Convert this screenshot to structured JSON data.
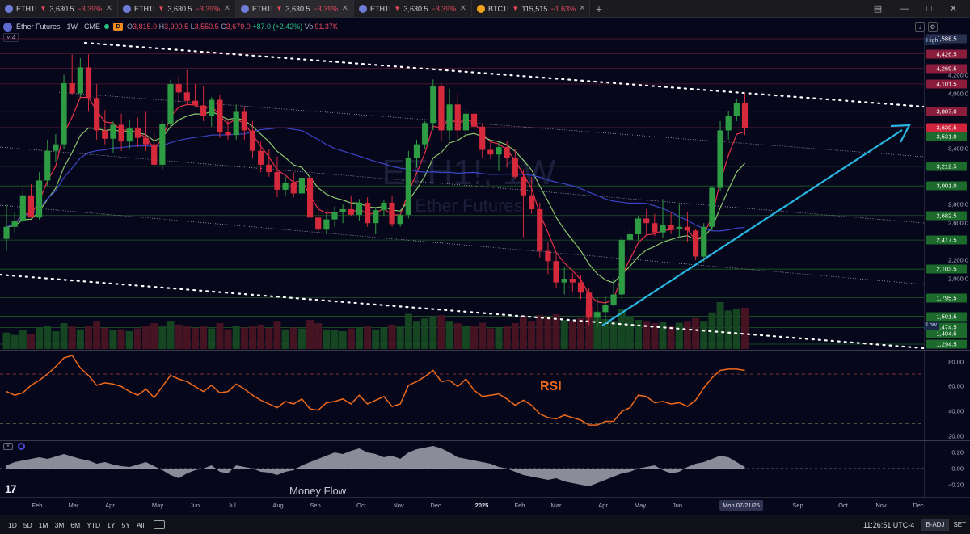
{
  "tabs": [
    {
      "symbol": "ETH1!",
      "price": "3,630.5",
      "change": "−3.39%",
      "coin": "eth"
    },
    {
      "symbol": "ETH1!",
      "price": "3,630.5",
      "change": "−3.39%",
      "coin": "eth"
    },
    {
      "symbol": "ETH1!",
      "price": "3,630.5",
      "change": "−3.39%",
      "coin": "eth"
    },
    {
      "symbol": "ETH1!",
      "price": "3,630.5",
      "change": "−3.39%",
      "coin": "eth"
    },
    {
      "symbol": "BTC1!",
      "price": "115,515",
      "change": "−1.63%",
      "coin": "btc"
    }
  ],
  "tab_add_label": "+",
  "window": {
    "layout_icon": "▤",
    "minimize": "—",
    "maximize": "□",
    "close": "✕"
  },
  "legend": {
    "title": "Ether Futures · 1W · CME",
    "badge": "D",
    "o_label": "O",
    "o": "3,815.0",
    "h_label": "H",
    "h": "3,900.5",
    "l_label": "L",
    "l": "3,550.5",
    "c_label": "C",
    "c": "3,679.0",
    "chg": "+87.0 (+2.42%)",
    "vol_label": "Vol",
    "vol": "91.37K",
    "collapse_label": "˅ 4"
  },
  "watermark": {
    "symbol": "ETH1!, 1W",
    "name": "Ether Futures"
  },
  "price_labels": [
    "4,200.0",
    "4,000.0",
    "3,400.0",
    "2,800.0",
    "2,600.0",
    "2,200.0",
    "2,000.0"
  ],
  "price_badges": [
    {
      "text": "4,588.5",
      "color": "#2a3150",
      "price": 4588.5
    },
    {
      "text": "4,426.5",
      "color": "#8a1d3c",
      "price": 4426.5
    },
    {
      "text": "4,269.5",
      "color": "#8a1d3c",
      "price": 4269.5
    },
    {
      "text": "4,101.5",
      "color": "#8a1d3c",
      "price": 4101.5
    },
    {
      "text": "3,807.0",
      "color": "#8a1d3c",
      "price": 3807.0
    },
    {
      "text": "3,630.5",
      "color": "#d2243c",
      "price": 3630.5
    },
    {
      "text": "3,531.0",
      "color": "#1c6b2c",
      "price": 3531.0
    },
    {
      "text": "3,212.5",
      "color": "#1c6b2c",
      "price": 3212.5
    },
    {
      "text": "3,001.0",
      "color": "#1c6b2c",
      "price": 3001.0
    },
    {
      "text": "2,682.5",
      "color": "#1c6b2c",
      "price": 2682.5
    },
    {
      "text": "2,417.5",
      "color": "#1c6b2c",
      "price": 2417.5
    },
    {
      "text": "2,103.5",
      "color": "#1c6b2c",
      "price": 2103.5
    },
    {
      "text": "1,795.5",
      "color": "#1c6b2c",
      "price": 1795.5
    },
    {
      "text": "1,591.5",
      "color": "#1c6b2c",
      "price": 1591.5
    },
    {
      "text": "1,474.5",
      "color": "#1c6b2c",
      "price": 1474.5
    },
    {
      "text": "1,404.5",
      "color": "#1c6b2c",
      "price": 1404.5
    },
    {
      "text": "1,294.5",
      "color": "#1c6b2c",
      "price": 1294.5
    }
  ],
  "high_tag": "High",
  "low_tag": "Low",
  "rsi": {
    "title": "RSI",
    "levels": [
      "80.00",
      "60.00",
      "40.00",
      "20.00"
    ]
  },
  "money_flow": {
    "title": "Money Flow",
    "levels": [
      "0.20",
      "0.00",
      "−0.20"
    ],
    "toggle_label": "˅"
  },
  "time_labels": [
    {
      "text": "Feb",
      "x": 46
    },
    {
      "text": "Mar",
      "x": 91
    },
    {
      "text": "Apr",
      "x": 136
    },
    {
      "text": "May",
      "x": 195
    },
    {
      "text": "Jun",
      "x": 241
    },
    {
      "text": "Jul",
      "x": 287
    },
    {
      "text": "Aug",
      "x": 344
    },
    {
      "text": "Sep",
      "x": 390
    },
    {
      "text": "Oct",
      "x": 447
    },
    {
      "text": "Nov",
      "x": 493
    },
    {
      "text": "Dec",
      "x": 539
    },
    {
      "text": "2025",
      "x": 596,
      "year": true
    },
    {
      "text": "Feb",
      "x": 643
    },
    {
      "text": "Mar",
      "x": 688
    },
    {
      "text": "Apr",
      "x": 746
    },
    {
      "text": "May",
      "x": 792
    },
    {
      "text": "Jun",
      "x": 838
    },
    {
      "text": "Sep",
      "x": 987
    },
    {
      "text": "Oct",
      "x": 1043
    },
    {
      "text": "Nov",
      "x": 1090
    },
    {
      "text": "Dec",
      "x": 1136
    }
  ],
  "cursor_date": "Mon 07/21/25",
  "tv_logo": "17",
  "bottom": {
    "ranges": [
      "1D",
      "5D",
      "1M",
      "3M",
      "6M",
      "YTD",
      "1Y",
      "5Y",
      "All"
    ],
    "clock": "11:26:51 UTC-4",
    "adj": "B-ADJ",
    "set": "SET"
  },
  "colors": {
    "bull": "#2e9c43",
    "bear": "#d42a3c",
    "ema_fast": "#e8334a",
    "ema_slow": "#8cc46b",
    "ma_long": "#3b45c8",
    "rsi": "#f06a1b",
    "trend_arrow": "#29b6e0",
    "mf_fill": "#b8b8c4"
  },
  "chart_data": {
    "type": "candlestick",
    "symbol": "ETH1!",
    "timeframe": "1W",
    "ylim": [
      1294.5,
      4588.5
    ],
    "ohlc": [
      [
        2430,
        2800,
        2300,
        2560
      ],
      [
        2560,
        2720,
        2500,
        2620
      ],
      [
        2620,
        2980,
        2600,
        2900
      ],
      [
        2900,
        3020,
        2820,
        2660
      ],
      [
        2660,
        3150,
        2640,
        3060
      ],
      [
        3060,
        3500,
        3000,
        3380
      ],
      [
        3380,
        3560,
        3260,
        3450
      ],
      [
        3450,
        4200,
        3400,
        4110
      ],
      [
        4110,
        4420,
        3980,
        4000
      ],
      [
        4000,
        4380,
        3960,
        4280
      ],
      [
        4280,
        4420,
        3800,
        3950
      ],
      [
        3950,
        4100,
        3500,
        3600
      ],
      [
        3600,
        3820,
        3450,
        3510
      ],
      [
        3510,
        3700,
        3350,
        3660
      ],
      [
        3660,
        3780,
        3380,
        3480
      ],
      [
        3480,
        3720,
        3400,
        3620
      ],
      [
        3620,
        3740,
        3420,
        3520
      ],
      [
        3520,
        3800,
        3380,
        3450
      ],
      [
        3450,
        3600,
        3200,
        3230
      ],
      [
        3230,
        3700,
        3180,
        3670
      ],
      [
        3670,
        4150,
        3640,
        4100
      ],
      [
        4100,
        4180,
        3900,
        4010
      ],
      [
        4010,
        4250,
        3880,
        3920
      ],
      [
        3920,
        4100,
        3850,
        3870
      ],
      [
        3870,
        4080,
        3700,
        3760
      ],
      [
        3760,
        3960,
        3640,
        3930
      ],
      [
        3930,
        3980,
        3520,
        3580
      ],
      [
        3580,
        3720,
        3500,
        3550
      ],
      [
        3550,
        3880,
        3500,
        3800
      ],
      [
        3800,
        3860,
        3500,
        3600
      ],
      [
        3600,
        3700,
        3300,
        3380
      ],
      [
        3380,
        3480,
        3150,
        3230
      ],
      [
        3230,
        3400,
        3100,
        3150
      ],
      [
        3150,
        3320,
        2880,
        2960
      ],
      [
        2960,
        3100,
        2900,
        3030
      ],
      [
        3030,
        3150,
        2880,
        2920
      ],
      [
        2920,
        3080,
        2850,
        3090
      ],
      [
        3090,
        3200,
        2620,
        2660
      ],
      [
        2660,
        2800,
        2500,
        2530
      ],
      [
        2530,
        2700,
        2480,
        2640
      ],
      [
        2640,
        2780,
        2560,
        2720
      ],
      [
        2720,
        2800,
        2600,
        2750
      ],
      [
        2750,
        2900,
        2680,
        2690
      ],
      [
        2690,
        2860,
        2620,
        2820
      ],
      [
        2820,
        2880,
        2560,
        2600
      ],
      [
        2600,
        2770,
        2480,
        2740
      ],
      [
        2740,
        2850,
        2680,
        2820
      ],
      [
        2820,
        2900,
        2560,
        2590
      ],
      [
        2590,
        2700,
        2560,
        2690
      ],
      [
        2690,
        3380,
        2650,
        3300
      ],
      [
        3300,
        3500,
        3200,
        3450
      ],
      [
        3450,
        3700,
        3400,
        3680
      ],
      [
        3680,
        4150,
        3600,
        4080
      ],
      [
        4080,
        4108,
        3480,
        3600
      ],
      [
        3600,
        4050,
        3500,
        3880
      ],
      [
        3880,
        4000,
        3500,
        3600
      ],
      [
        3600,
        3840,
        3520,
        3780
      ],
      [
        3780,
        3800,
        3450,
        3640
      ],
      [
        3640,
        3680,
        3300,
        3390
      ],
      [
        3390,
        3500,
        3290,
        3340
      ],
      [
        3340,
        3470,
        3160,
        3420
      ],
      [
        3420,
        3480,
        3200,
        3300
      ],
      [
        3300,
        3400,
        3080,
        3100
      ],
      [
        3100,
        3180,
        2450,
        2900
      ],
      [
        2900,
        3100,
        2700,
        2750
      ],
      [
        2750,
        2820,
        2230,
        2300
      ],
      [
        2300,
        2400,
        2050,
        2190
      ],
      [
        2190,
        2280,
        1900,
        1960
      ],
      [
        1960,
        2120,
        1830,
        2000
      ],
      [
        2000,
        2060,
        1850,
        1960
      ],
      [
        1960,
        2040,
        1780,
        1850
      ],
      [
        1850,
        1900,
        1500,
        1580
      ],
      [
        1580,
        1800,
        1470,
        1640
      ],
      [
        1640,
        1820,
        1540,
        1720
      ],
      [
        1720,
        2000,
        1700,
        1830
      ],
      [
        1830,
        2450,
        1780,
        2420
      ],
      [
        2420,
        2550,
        2300,
        2480
      ],
      [
        2480,
        2680,
        2410,
        2650
      ],
      [
        2650,
        2750,
        2470,
        2600
      ],
      [
        2600,
        2700,
        2460,
        2500
      ],
      [
        2500,
        2860,
        2440,
        2580
      ],
      [
        2580,
        2720,
        2480,
        2540
      ],
      [
        2540,
        2800,
        2440,
        2560
      ],
      [
        2560,
        2720,
        2400,
        2520
      ],
      [
        2520,
        2540,
        2200,
        2240
      ],
      [
        2240,
        2600,
        2180,
        2560
      ],
      [
        2560,
        3000,
        2520,
        2980
      ],
      [
        2980,
        3700,
        2950,
        3600
      ],
      [
        3600,
        3810,
        3500,
        3760
      ],
      [
        3760,
        3940,
        3700,
        3900
      ],
      [
        3900,
        4000,
        3550,
        3630
      ]
    ],
    "volume_relative": [
      0.35,
      0.3,
      0.4,
      0.32,
      0.45,
      0.5,
      0.38,
      0.55,
      0.48,
      0.42,
      0.5,
      0.6,
      0.45,
      0.4,
      0.42,
      0.38,
      0.44,
      0.5,
      0.55,
      0.48,
      0.6,
      0.52,
      0.5,
      0.45,
      0.48,
      0.44,
      0.55,
      0.42,
      0.5,
      0.46,
      0.48,
      0.52,
      0.45,
      0.6,
      0.42,
      0.46,
      0.44,
      0.62,
      0.55,
      0.42,
      0.4,
      0.38,
      0.44,
      0.46,
      0.5,
      0.42,
      0.45,
      0.52,
      0.48,
      0.75,
      0.6,
      0.65,
      0.7,
      0.72,
      0.6,
      0.55,
      0.5,
      0.48,
      0.56,
      0.44,
      0.46,
      0.5,
      0.55,
      0.7,
      0.6,
      0.72,
      0.68,
      0.74,
      0.62,
      0.6,
      0.66,
      0.9,
      0.8,
      0.64,
      0.6,
      0.85,
      0.7,
      0.62,
      0.6,
      0.55,
      0.58,
      0.5,
      0.56,
      0.6,
      0.66,
      0.6,
      0.78,
      1.0,
      0.82,
      0.86,
      0.88
    ],
    "rsi": [
      56,
      53,
      55,
      61,
      65,
      70,
      76,
      83,
      85,
      75,
      69,
      61,
      63,
      62,
      60,
      56,
      53,
      58,
      51,
      60,
      69,
      66,
      64,
      60,
      56,
      61,
      55,
      56,
      62,
      58,
      53,
      49,
      46,
      43,
      48,
      46,
      50,
      42,
      41,
      47,
      48,
      50,
      46,
      53,
      46,
      49,
      52,
      44,
      46,
      61,
      64,
      68,
      73,
      64,
      65,
      60,
      66,
      57,
      52,
      53,
      54,
      50,
      45,
      49,
      45,
      38,
      35,
      34,
      37,
      35,
      33,
      29,
      29,
      32,
      32,
      40,
      43,
      53,
      52,
      47,
      48,
      46,
      47,
      44,
      49,
      59,
      67,
      73,
      74,
      74,
      73
    ],
    "rsi_levels": [
      70,
      30
    ],
    "money_flow": [
      0.04,
      0.08,
      0.1,
      0.12,
      0.14,
      0.12,
      0.15,
      0.18,
      0.15,
      0.12,
      0.1,
      0.06,
      0.08,
      0.05,
      0.03,
      0.02,
      0.05,
      0.08,
      0.03,
      -0.02,
      -0.08,
      -0.12,
      -0.06,
      -0.02,
      0.0,
      0.04,
      -0.04,
      -0.06,
      0.04,
      0.02,
      0.0,
      -0.04,
      -0.05,
      -0.08,
      -0.04,
      -0.02,
      0.04,
      0.08,
      0.12,
      0.16,
      0.2,
      0.18,
      0.22,
      0.25,
      0.2,
      0.18,
      0.14,
      0.16,
      0.12,
      0.2,
      0.24,
      0.26,
      0.28,
      0.25,
      0.2,
      0.14,
      0.12,
      0.1,
      0.08,
      0.06,
      0.02,
      0.0,
      -0.04,
      -0.08,
      -0.1,
      -0.12,
      -0.14,
      -0.12,
      -0.16,
      -0.18,
      -0.2,
      -0.22,
      -0.18,
      -0.14,
      -0.1,
      -0.06,
      -0.04,
      0.0,
      0.02,
      0.04,
      -0.02,
      -0.06,
      -0.04,
      0.02,
      0.06,
      0.08,
      0.12,
      0.16,
      0.14,
      0.08,
      0.02
    ]
  }
}
